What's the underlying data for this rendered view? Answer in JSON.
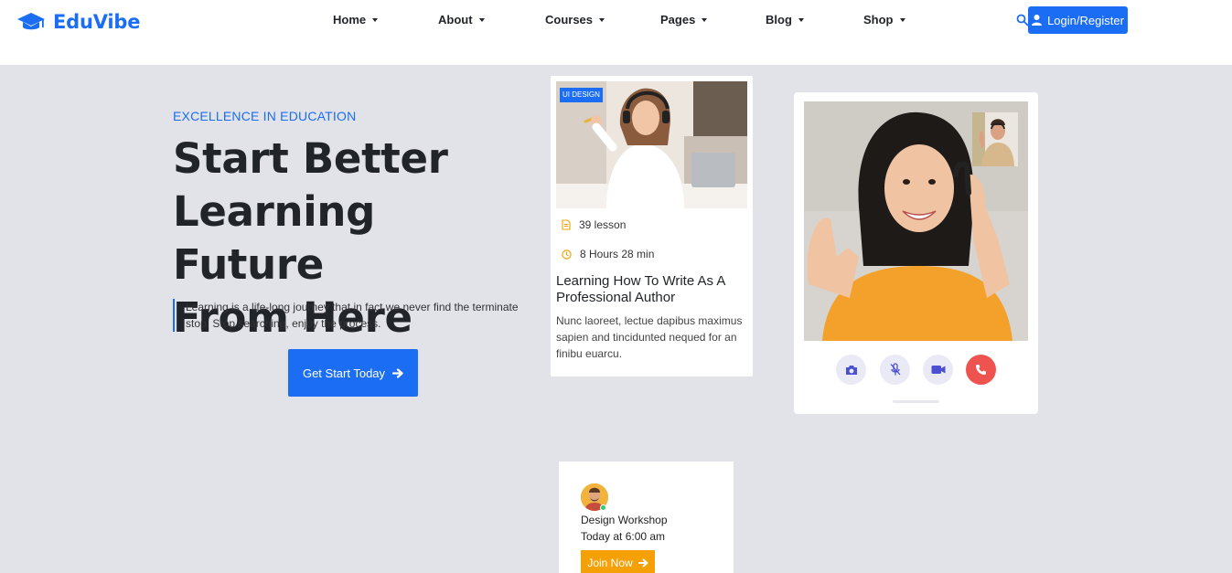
{
  "brand": {
    "name": "EduVibe",
    "color": "#1b6ef3",
    "icon": "graduation-cap-icon"
  },
  "nav": {
    "items": [
      {
        "label": "Home"
      },
      {
        "label": "About"
      },
      {
        "label": "Courses"
      },
      {
        "label": "Pages"
      },
      {
        "label": "Blog"
      },
      {
        "label": "Shop"
      }
    ],
    "search_icon": "search-icon",
    "login_label": "Login/Register",
    "login_icon": "user-icon"
  },
  "hero": {
    "eyebrow": "EXCELLENCE IN EDUCATION",
    "title_line1": "Start Better",
    "title_line2": "Learning Future",
    "title_line3": "From Here",
    "description": "Learning is a life-long journey that in fact we never find the terminate stop. Stop searching, enjoy the process.",
    "cta_label": "Get Start Today",
    "cta_icon": "arrow-right-icon"
  },
  "course_card": {
    "tag": "UI DESIGN",
    "lessons": "39 lesson",
    "duration": "8 Hours 28 min",
    "title": "Learning How To Write As A Professional Author",
    "description": "Nunc laoreet, lectue dapibus maximus sapien and tincidunted nequed for an finibu euarcu.",
    "accent": "#f5a006"
  },
  "video_call": {
    "controls": [
      {
        "name": "camera-icon"
      },
      {
        "name": "mic-off-icon"
      },
      {
        "name": "video-icon"
      },
      {
        "name": "phone-end-icon"
      }
    ],
    "end_call_color": "#ef5350"
  },
  "workshop": {
    "title": "Design Workshop",
    "time": "Today at 6:00 am",
    "join_label": "Join Now",
    "join_color": "#f5a006"
  }
}
